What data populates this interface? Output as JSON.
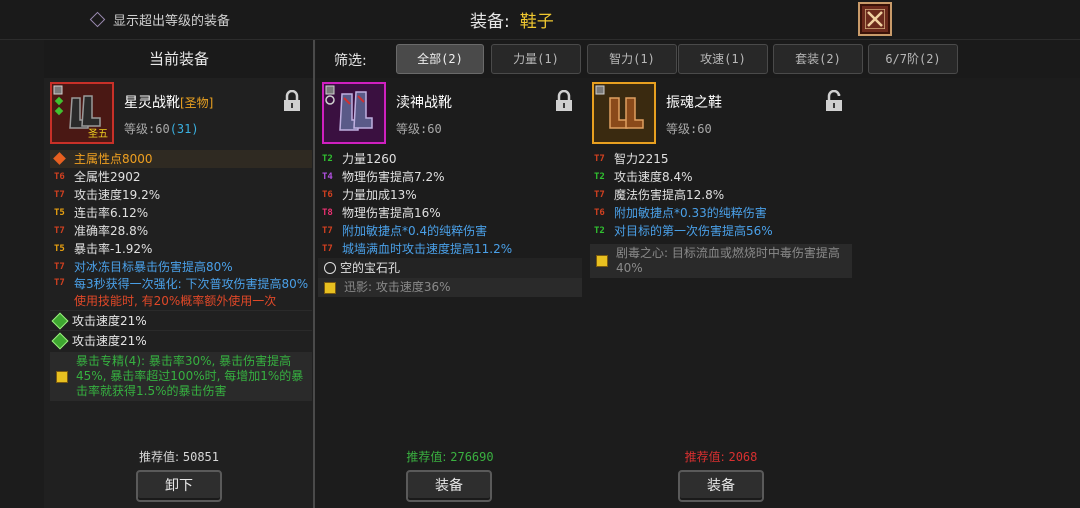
{
  "topbar": {
    "show_over_level_label": "显示超出等级的装备",
    "title_prefix": "装备:",
    "title_slot": "鞋子"
  },
  "left_panel": {
    "header": "当前装备"
  },
  "filter": {
    "label": "筛选:",
    "tabs": [
      {
        "label": "全部(2)",
        "active": true
      },
      {
        "label": "力量(1)",
        "active": false
      },
      {
        "label": "智力(1)",
        "active": false
      },
      {
        "label": "攻速(1)",
        "active": false
      },
      {
        "label": "套装(2)",
        "active": false
      },
      {
        "label": "6/7阶(2)",
        "active": false
      }
    ]
  },
  "items": [
    {
      "name": "星灵战靴",
      "tag": "[圣物]",
      "level_text": "等级:60",
      "level_bonus": "(31)",
      "icon_badge": "圣五",
      "frame_color": "#c83028",
      "stats": [
        {
          "tier": "",
          "text": "主属性点8000",
          "color": "orange",
          "highlight": true
        },
        {
          "tier": "T6",
          "text": "全属性2902",
          "color": "grey"
        },
        {
          "tier": "T7",
          "text": "攻击速度19.2%",
          "color": "grey"
        },
        {
          "tier": "T5",
          "text": "连击率6.12%",
          "color": "grey"
        },
        {
          "tier": "T7",
          "text": "准确率28.8%",
          "color": "grey"
        },
        {
          "tier": "T5",
          "text": "暴击率-1.92%",
          "color": "grey"
        },
        {
          "tier": "T7",
          "text": "对冰冻目标暴击伤害提高80%",
          "color": "blue"
        },
        {
          "tier": "T7",
          "text": "每3秒获得一次强化: 下次普攻伤害提高80%",
          "color": "blue"
        },
        {
          "tier": "",
          "text": "使用技能时, 有20%概率额外使用一次",
          "color": "red"
        }
      ],
      "gems": [
        "攻击速度21%",
        "攻击速度21%"
      ],
      "set_text": "暴击专精(4): 暴击率30%, 暴击伤害提高45%, 暴击率超过100%时, 每增加1%的暴击率就获得1.5%的暴击伤害",
      "score_label": "推荐值:",
      "score_value": "50851",
      "score_color": "#d8d8d8",
      "button_label": "卸下"
    },
    {
      "name": "渎神战靴",
      "level_text": "等级:60",
      "frame_color": "#d020c0",
      "stats": [
        {
          "tier": "T2",
          "text": "力量1260",
          "color": "grey"
        },
        {
          "tier": "T4",
          "text": "物理伤害提高7.2%",
          "color": "grey"
        },
        {
          "tier": "T6",
          "text": "力量加成13%",
          "color": "grey"
        },
        {
          "tier": "T8",
          "text": "物理伤害提高16%",
          "color": "grey"
        },
        {
          "tier": "T7",
          "text": "附加敏捷点*0.4的纯粹伤害",
          "color": "blue"
        },
        {
          "tier": "T7",
          "text": "城墙满血时攻击速度提高11.2%",
          "color": "blue"
        }
      ],
      "socket_text": "空的宝石孔",
      "set_text": "迅影: 攻击速度36%",
      "score_label": "推荐值:",
      "score_value": "276690",
      "score_color": "#3ab040",
      "button_label": "装备"
    },
    {
      "name": "振魂之鞋",
      "level_text": "等级:60",
      "frame_color": "#e8a020",
      "stats": [
        {
          "tier": "T7",
          "text": "智力2215",
          "color": "grey"
        },
        {
          "tier": "T2",
          "text": "攻击速度8.4%",
          "color": "grey"
        },
        {
          "tier": "T7",
          "text": "魔法伤害提高12.8%",
          "color": "grey"
        },
        {
          "tier": "T6",
          "text": "附加敏捷点*0.33的纯粹伤害",
          "color": "blue"
        },
        {
          "tier": "T2",
          "text": "对目标的第一次伤害提高56%",
          "color": "blue"
        }
      ],
      "set_text": "剧毒之心: 目标流血或燃烧时中毒伤害提高40%",
      "score_label": "推荐值:",
      "score_value": "2068",
      "score_color": "#d83030",
      "button_label": "装备"
    }
  ],
  "colors": {
    "tier_T2": "#30c030",
    "tier_T4": "#b050e0",
    "tier_T5": "#e8a010",
    "tier_T6": "#d04020",
    "tier_T7": "#d04020",
    "tier_T8": "#e83070"
  }
}
